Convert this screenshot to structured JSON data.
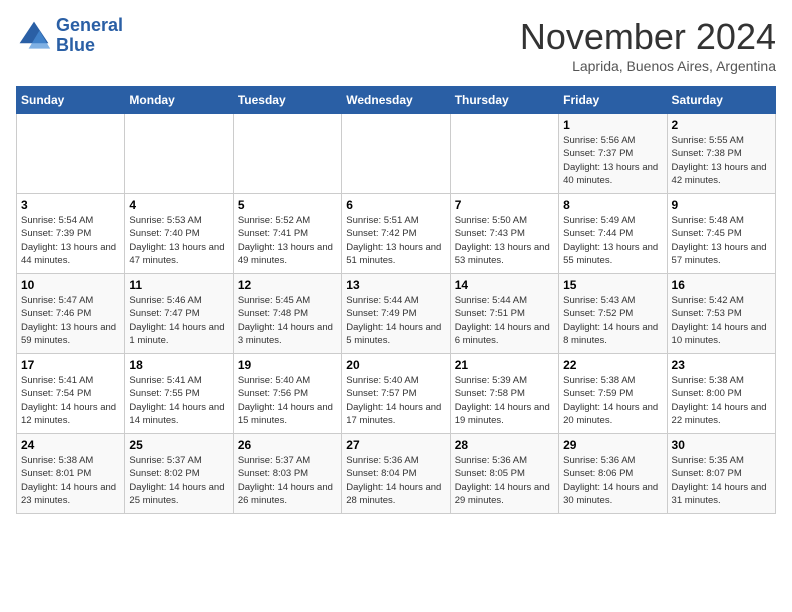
{
  "logo": {
    "line1": "General",
    "line2": "Blue"
  },
  "title": "November 2024",
  "location": "Laprida, Buenos Aires, Argentina",
  "days_of_week": [
    "Sunday",
    "Monday",
    "Tuesday",
    "Wednesday",
    "Thursday",
    "Friday",
    "Saturday"
  ],
  "weeks": [
    [
      {
        "day": "",
        "info": ""
      },
      {
        "day": "",
        "info": ""
      },
      {
        "day": "",
        "info": ""
      },
      {
        "day": "",
        "info": ""
      },
      {
        "day": "",
        "info": ""
      },
      {
        "day": "1",
        "info": "Sunrise: 5:56 AM\nSunset: 7:37 PM\nDaylight: 13 hours and 40 minutes."
      },
      {
        "day": "2",
        "info": "Sunrise: 5:55 AM\nSunset: 7:38 PM\nDaylight: 13 hours and 42 minutes."
      }
    ],
    [
      {
        "day": "3",
        "info": "Sunrise: 5:54 AM\nSunset: 7:39 PM\nDaylight: 13 hours and 44 minutes."
      },
      {
        "day": "4",
        "info": "Sunrise: 5:53 AM\nSunset: 7:40 PM\nDaylight: 13 hours and 47 minutes."
      },
      {
        "day": "5",
        "info": "Sunrise: 5:52 AM\nSunset: 7:41 PM\nDaylight: 13 hours and 49 minutes."
      },
      {
        "day": "6",
        "info": "Sunrise: 5:51 AM\nSunset: 7:42 PM\nDaylight: 13 hours and 51 minutes."
      },
      {
        "day": "7",
        "info": "Sunrise: 5:50 AM\nSunset: 7:43 PM\nDaylight: 13 hours and 53 minutes."
      },
      {
        "day": "8",
        "info": "Sunrise: 5:49 AM\nSunset: 7:44 PM\nDaylight: 13 hours and 55 minutes."
      },
      {
        "day": "9",
        "info": "Sunrise: 5:48 AM\nSunset: 7:45 PM\nDaylight: 13 hours and 57 minutes."
      }
    ],
    [
      {
        "day": "10",
        "info": "Sunrise: 5:47 AM\nSunset: 7:46 PM\nDaylight: 13 hours and 59 minutes."
      },
      {
        "day": "11",
        "info": "Sunrise: 5:46 AM\nSunset: 7:47 PM\nDaylight: 14 hours and 1 minute."
      },
      {
        "day": "12",
        "info": "Sunrise: 5:45 AM\nSunset: 7:48 PM\nDaylight: 14 hours and 3 minutes."
      },
      {
        "day": "13",
        "info": "Sunrise: 5:44 AM\nSunset: 7:49 PM\nDaylight: 14 hours and 5 minutes."
      },
      {
        "day": "14",
        "info": "Sunrise: 5:44 AM\nSunset: 7:51 PM\nDaylight: 14 hours and 6 minutes."
      },
      {
        "day": "15",
        "info": "Sunrise: 5:43 AM\nSunset: 7:52 PM\nDaylight: 14 hours and 8 minutes."
      },
      {
        "day": "16",
        "info": "Sunrise: 5:42 AM\nSunset: 7:53 PM\nDaylight: 14 hours and 10 minutes."
      }
    ],
    [
      {
        "day": "17",
        "info": "Sunrise: 5:41 AM\nSunset: 7:54 PM\nDaylight: 14 hours and 12 minutes."
      },
      {
        "day": "18",
        "info": "Sunrise: 5:41 AM\nSunset: 7:55 PM\nDaylight: 14 hours and 14 minutes."
      },
      {
        "day": "19",
        "info": "Sunrise: 5:40 AM\nSunset: 7:56 PM\nDaylight: 14 hours and 15 minutes."
      },
      {
        "day": "20",
        "info": "Sunrise: 5:40 AM\nSunset: 7:57 PM\nDaylight: 14 hours and 17 minutes."
      },
      {
        "day": "21",
        "info": "Sunrise: 5:39 AM\nSunset: 7:58 PM\nDaylight: 14 hours and 19 minutes."
      },
      {
        "day": "22",
        "info": "Sunrise: 5:38 AM\nSunset: 7:59 PM\nDaylight: 14 hours and 20 minutes."
      },
      {
        "day": "23",
        "info": "Sunrise: 5:38 AM\nSunset: 8:00 PM\nDaylight: 14 hours and 22 minutes."
      }
    ],
    [
      {
        "day": "24",
        "info": "Sunrise: 5:38 AM\nSunset: 8:01 PM\nDaylight: 14 hours and 23 minutes."
      },
      {
        "day": "25",
        "info": "Sunrise: 5:37 AM\nSunset: 8:02 PM\nDaylight: 14 hours and 25 minutes."
      },
      {
        "day": "26",
        "info": "Sunrise: 5:37 AM\nSunset: 8:03 PM\nDaylight: 14 hours and 26 minutes."
      },
      {
        "day": "27",
        "info": "Sunrise: 5:36 AM\nSunset: 8:04 PM\nDaylight: 14 hours and 28 minutes."
      },
      {
        "day": "28",
        "info": "Sunrise: 5:36 AM\nSunset: 8:05 PM\nDaylight: 14 hours and 29 minutes."
      },
      {
        "day": "29",
        "info": "Sunrise: 5:36 AM\nSunset: 8:06 PM\nDaylight: 14 hours and 30 minutes."
      },
      {
        "day": "30",
        "info": "Sunrise: 5:35 AM\nSunset: 8:07 PM\nDaylight: 14 hours and 31 minutes."
      }
    ]
  ]
}
